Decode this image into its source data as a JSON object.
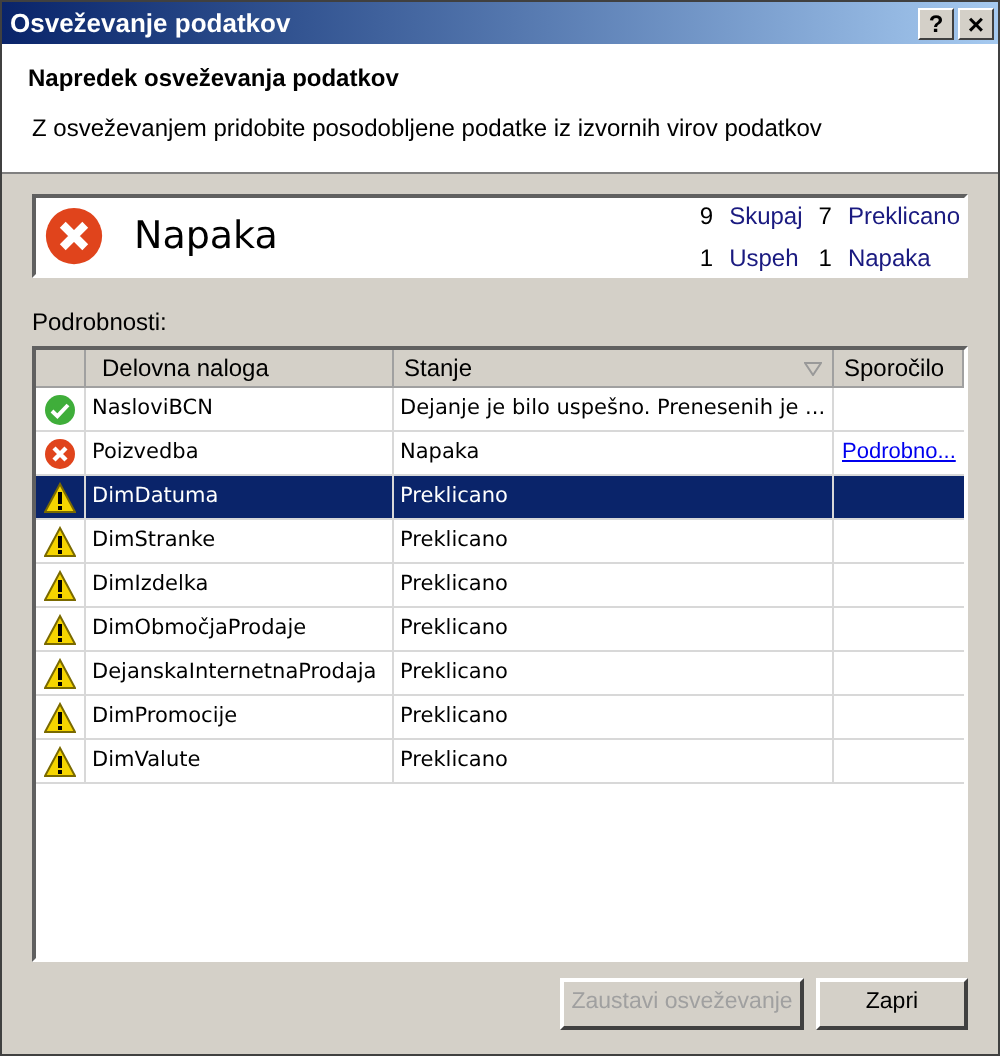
{
  "window": {
    "title": "Osveževanje podatkov",
    "help": "?",
    "close": "×"
  },
  "header": {
    "title": "Napredek osveževanja podatkov",
    "subtitle": "Z osveževanjem pridobite posodobljene podatke iz izvornih virov podatkov"
  },
  "status": {
    "kind": "error",
    "text": "Napaka",
    "counts": [
      {
        "number": "9",
        "label": "Skupaj"
      },
      {
        "number": "7",
        "label": "Preklicano"
      },
      {
        "number": "1",
        "label": "Uspeh"
      },
      {
        "number": "1",
        "label": "Napaka"
      }
    ]
  },
  "details_label": "Podrobnosti:",
  "table": {
    "columns": [
      "Delovna naloga",
      "Stanje",
      "Sporočilo"
    ],
    "rows": [
      {
        "kind": "success",
        "task": "NasloviBCN",
        "state": "Dejanje je bilo uspešno. Prenesenih je ...",
        "selected": false
      },
      {
        "kind": "error",
        "task": "Poizvedba",
        "state": "Napaka",
        "message": "Podrobno...",
        "selected": false
      },
      {
        "kind": "warning",
        "task": "DimDatuma",
        "state": "Preklicano",
        "selected": true
      },
      {
        "kind": "warning",
        "task": "DimStranke",
        "state": "Preklicano",
        "selected": false
      },
      {
        "kind": "warning",
        "task": "DimIzdelka",
        "state": "Preklicano",
        "selected": false
      },
      {
        "kind": "warning",
        "task": "DimObmočjaProdaje",
        "state": "Preklicano",
        "selected": false
      },
      {
        "kind": "warning",
        "task": "DejanskaInternetnaProdaja",
        "state": "Preklicano",
        "selected": false
      },
      {
        "kind": "warning",
        "task": "DimPromocije",
        "state": "Preklicano",
        "selected": false
      },
      {
        "kind": "warning",
        "task": "DimValute",
        "state": "Preklicano",
        "selected": false
      }
    ]
  },
  "buttons": [
    {
      "label": "Zaustavi osveževanje",
      "disabled": true
    },
    {
      "label": "Zapri",
      "disabled": false
    }
  ]
}
